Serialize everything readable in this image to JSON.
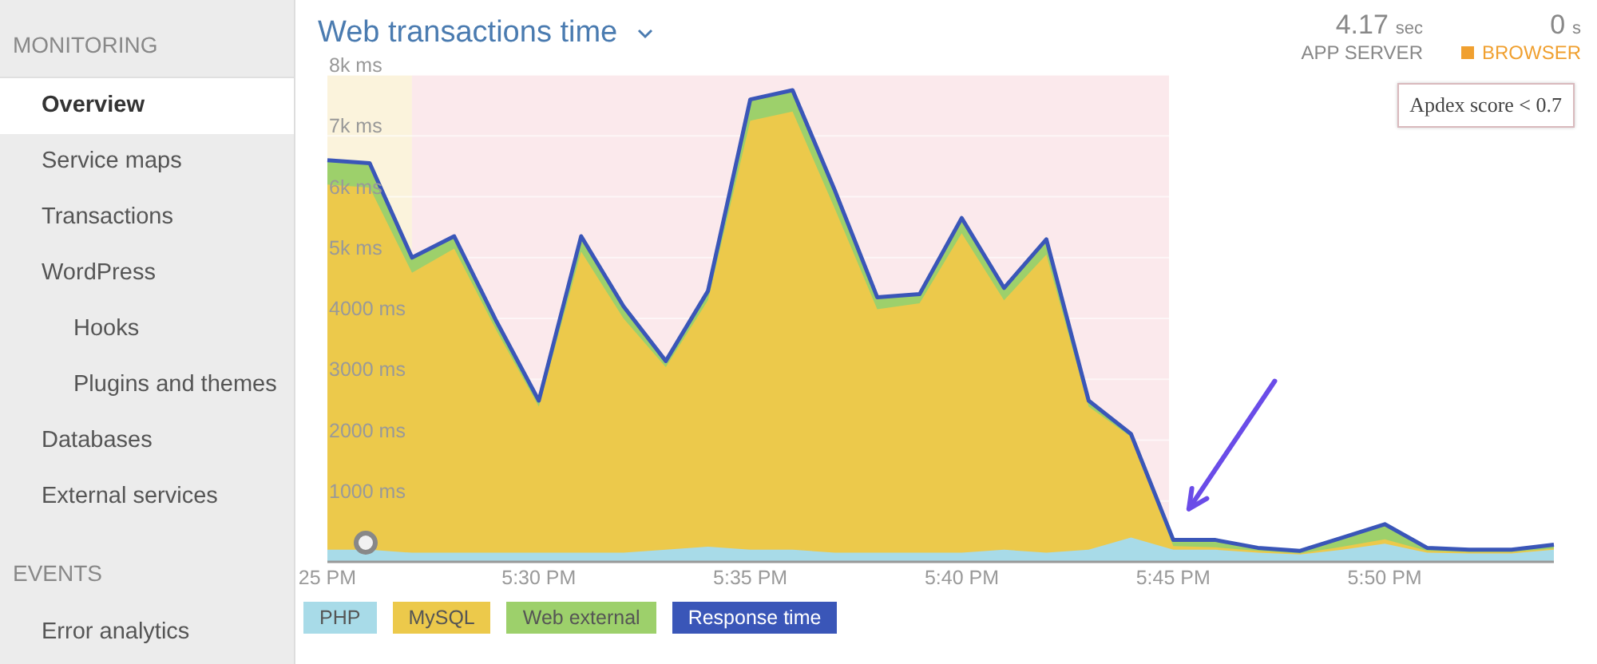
{
  "sidebar": {
    "sections": [
      {
        "title": "MONITORING",
        "items": [
          {
            "label": "Overview",
            "selected": true
          },
          {
            "label": "Service maps",
            "selected": false
          },
          {
            "label": "Transactions",
            "selected": false
          },
          {
            "label": "WordPress",
            "selected": false,
            "children": [
              {
                "label": "Hooks",
                "selected": false
              },
              {
                "label": "Plugins and themes",
                "selected": false
              }
            ]
          },
          {
            "label": "Databases",
            "selected": false
          },
          {
            "label": "External services",
            "selected": false
          }
        ]
      },
      {
        "title": "EVENTS",
        "items": [
          {
            "label": "Error analytics",
            "selected": false
          }
        ]
      }
    ]
  },
  "header": {
    "title": "Web transactions time",
    "stats": [
      {
        "value": "4.17",
        "unit": "sec",
        "label": "APP SERVER"
      },
      {
        "value": "0",
        "unit": "s",
        "label": "BROWSER",
        "color": "#f0a030"
      }
    ]
  },
  "tooltip": "Apdex score < 0.7",
  "chart_data": {
    "type": "area",
    "stacked": false,
    "grid": true,
    "categories": [
      "25 PM",
      null,
      null,
      null,
      null,
      "5:30 PM",
      null,
      null,
      null,
      null,
      "5:35 PM",
      null,
      null,
      null,
      null,
      "5:40 PM",
      null,
      null,
      null,
      null,
      "5:45 PM",
      null,
      null,
      null,
      null,
      "5:50 PM",
      null,
      null,
      null,
      null
    ],
    "ylim": [
      0,
      8000
    ],
    "yticks": [
      {
        "value": 1000,
        "label": "1000 ms"
      },
      {
        "value": 2000,
        "label": "2000 ms"
      },
      {
        "value": 3000,
        "label": "3000 ms"
      },
      {
        "value": 4000,
        "label": "4000 ms"
      },
      {
        "value": 5000,
        "label": "5k ms"
      },
      {
        "value": 6000,
        "label": "6k ms"
      },
      {
        "value": 7000,
        "label": "7k ms"
      },
      {
        "value": 8000,
        "label": "8k ms"
      }
    ],
    "series": [
      {
        "name": "PHP",
        "color": "#a8dbe8",
        "values": [
          200,
          200,
          150,
          150,
          150,
          150,
          150,
          150,
          200,
          250,
          200,
          200,
          150,
          150,
          150,
          150,
          200,
          150,
          200,
          400,
          200,
          200,
          150,
          120,
          200,
          300,
          150,
          140,
          140,
          200
        ]
      },
      {
        "name": "MySQL",
        "color": "#ecc94b",
        "values": [
          6200,
          6150,
          4750,
          5150,
          3800,
          2550,
          5100,
          4000,
          3200,
          4300,
          7250,
          7400,
          5800,
          4150,
          4250,
          5400,
          4300,
          5050,
          2550,
          2050,
          260,
          240,
          180,
          140,
          250,
          370,
          180,
          160,
          160,
          220
        ]
      },
      {
        "name": "Web external",
        "color": "#9dd06b",
        "values": [
          6600,
          6550,
          5000,
          5350,
          3950,
          2650,
          5350,
          4200,
          3300,
          4450,
          7600,
          7750,
          6100,
          4350,
          4400,
          5650,
          4500,
          5300,
          2650,
          2100,
          360,
          360,
          230,
          180,
          400,
          620,
          230,
          200,
          200,
          280
        ]
      },
      {
        "name": "Response time",
        "type": "line",
        "color": "#3a56b8",
        "values": [
          6600,
          6550,
          5000,
          5350,
          3950,
          2650,
          5350,
          4200,
          3300,
          4450,
          7600,
          7750,
          6100,
          4350,
          4400,
          5650,
          4500,
          5300,
          2650,
          2100,
          360,
          360,
          230,
          180,
          400,
          620,
          230,
          200,
          200,
          280
        ]
      }
    ]
  }
}
